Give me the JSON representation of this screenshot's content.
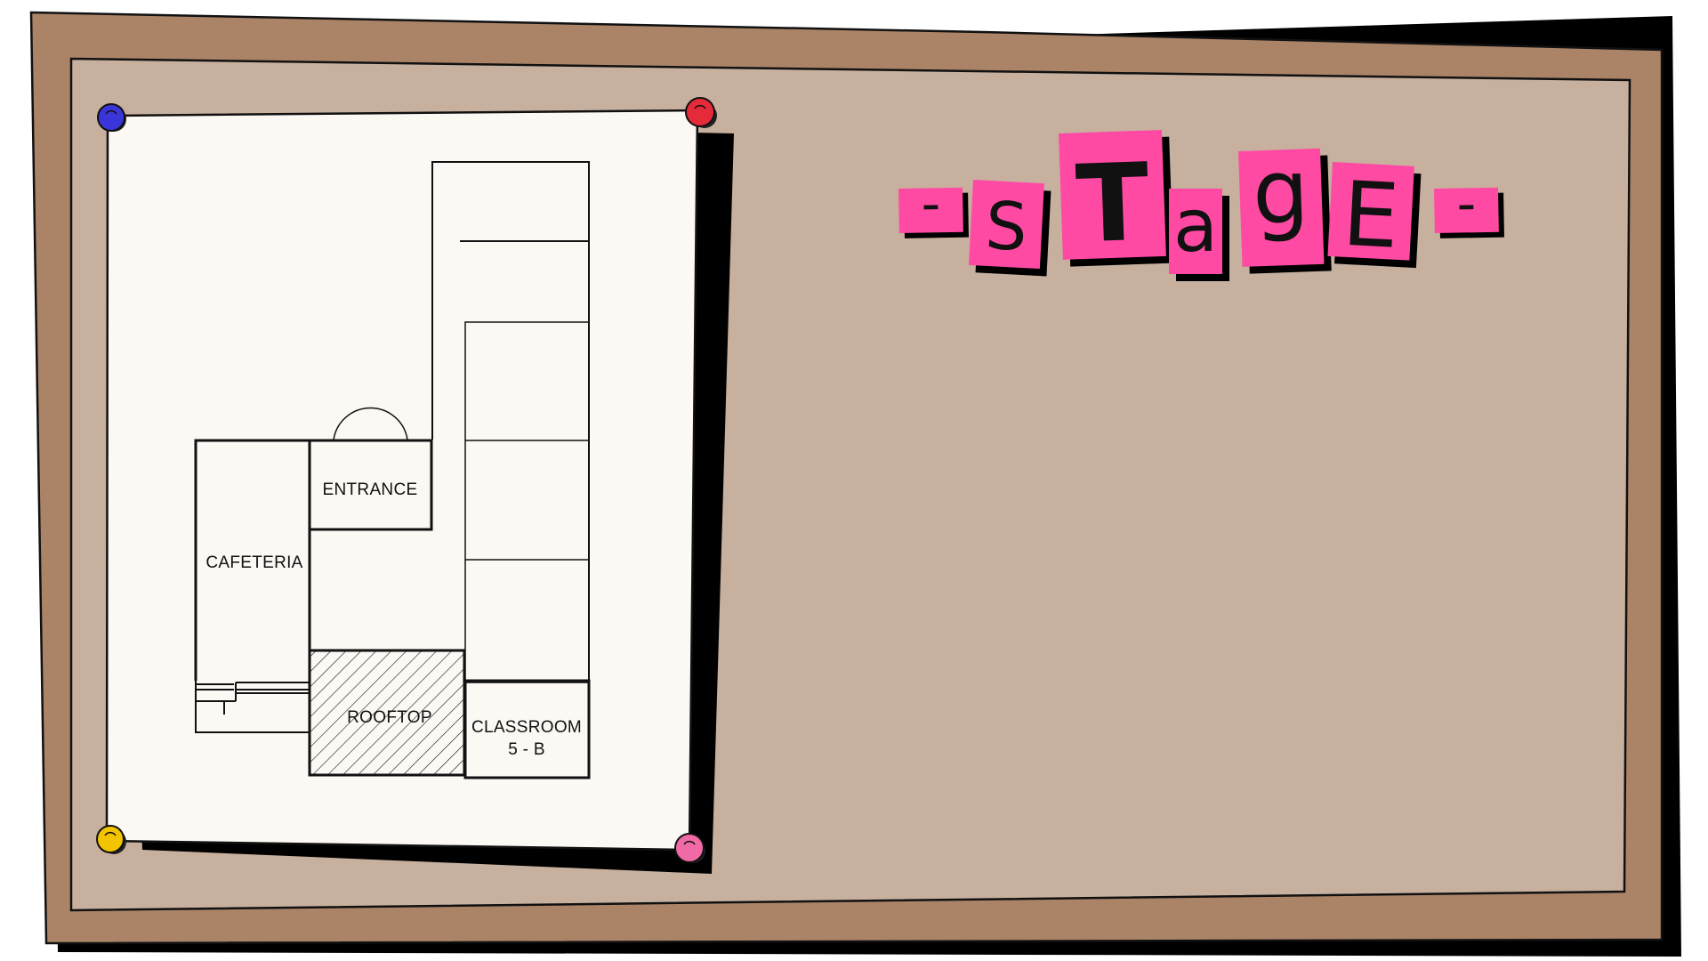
{
  "colors": {
    "frame": "#ab8468",
    "board": "#c8b09e",
    "paper": "#fcf8f4",
    "ink": "#111111",
    "accent": "#ff4aa4",
    "pin_blue": "#3a35d8",
    "pin_red": "#e52a3a",
    "pin_yellow": "#f2c400",
    "pin_pink": "#f06aa6"
  },
  "board": {
    "title": {
      "letters": [
        "-",
        "S",
        "T",
        "a",
        "g",
        "E",
        "-"
      ]
    }
  },
  "floor_plan": {
    "rooms": {
      "entrance": "ENTRANCE",
      "cafeteria": "CAFETERIA",
      "rooftop": "ROOFTOP",
      "classroom_line1": "CLASSROOM",
      "classroom_line2": "5 - B"
    }
  },
  "pins": [
    "blue",
    "red",
    "yellow",
    "pink"
  ]
}
